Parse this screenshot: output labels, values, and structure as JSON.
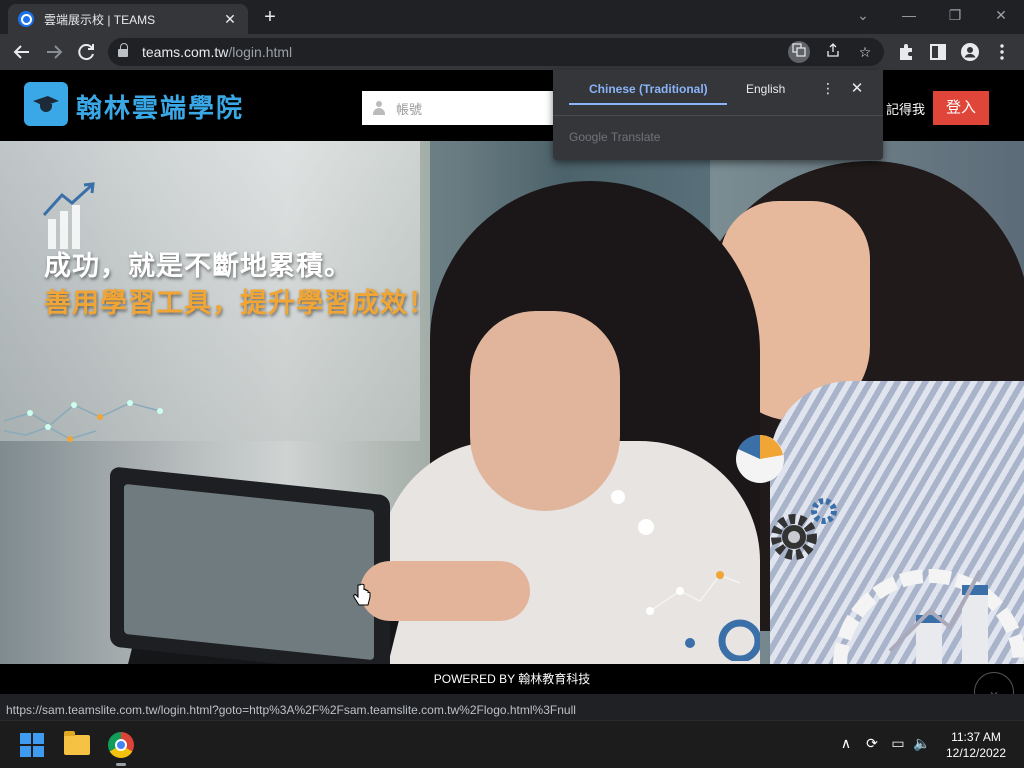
{
  "browser": {
    "tab_title": "雲端展示校 | TEAMS",
    "tab_close": "✕",
    "new_tab": "+",
    "minimize": "⌄",
    "restore": "—",
    "maximize": "❐",
    "close": "✕",
    "url_host": "teams.com.tw",
    "url_path": "/login.html",
    "status_url": "https://sam.teamslite.com.tw/login.html?goto=http%3A%2F%2Fsam.teamslite.com.tw%2Flogo.html%3Fnull"
  },
  "translate_popup": {
    "source_language": "Chinese (Traditional)",
    "target_language": "English",
    "menu": "⋮",
    "close": "✕",
    "brand": "Google Translate"
  },
  "site": {
    "logo_text": "翰林雲端學院",
    "username_placeholder": "帳號",
    "remember_me": "記得我",
    "login_button": "登入",
    "slogan_line1": "成功，就是不斷地累積。",
    "slogan_line2": "善用學習工具，提升學習成效！",
    "footer": "POWERED BY 翰林教育科技",
    "scroll_top": "⌄"
  },
  "taskbar": {
    "time": "11:37 AM",
    "date": "12/12/2022",
    "tray_chevron": "∧",
    "tray_sync": "⟳",
    "tray_display": "▭",
    "tray_volume": "🔈"
  },
  "colors": {
    "accent_blue": "#3aa7e6",
    "login_red": "#e0453a",
    "slogan_orange": "#f0a534"
  }
}
